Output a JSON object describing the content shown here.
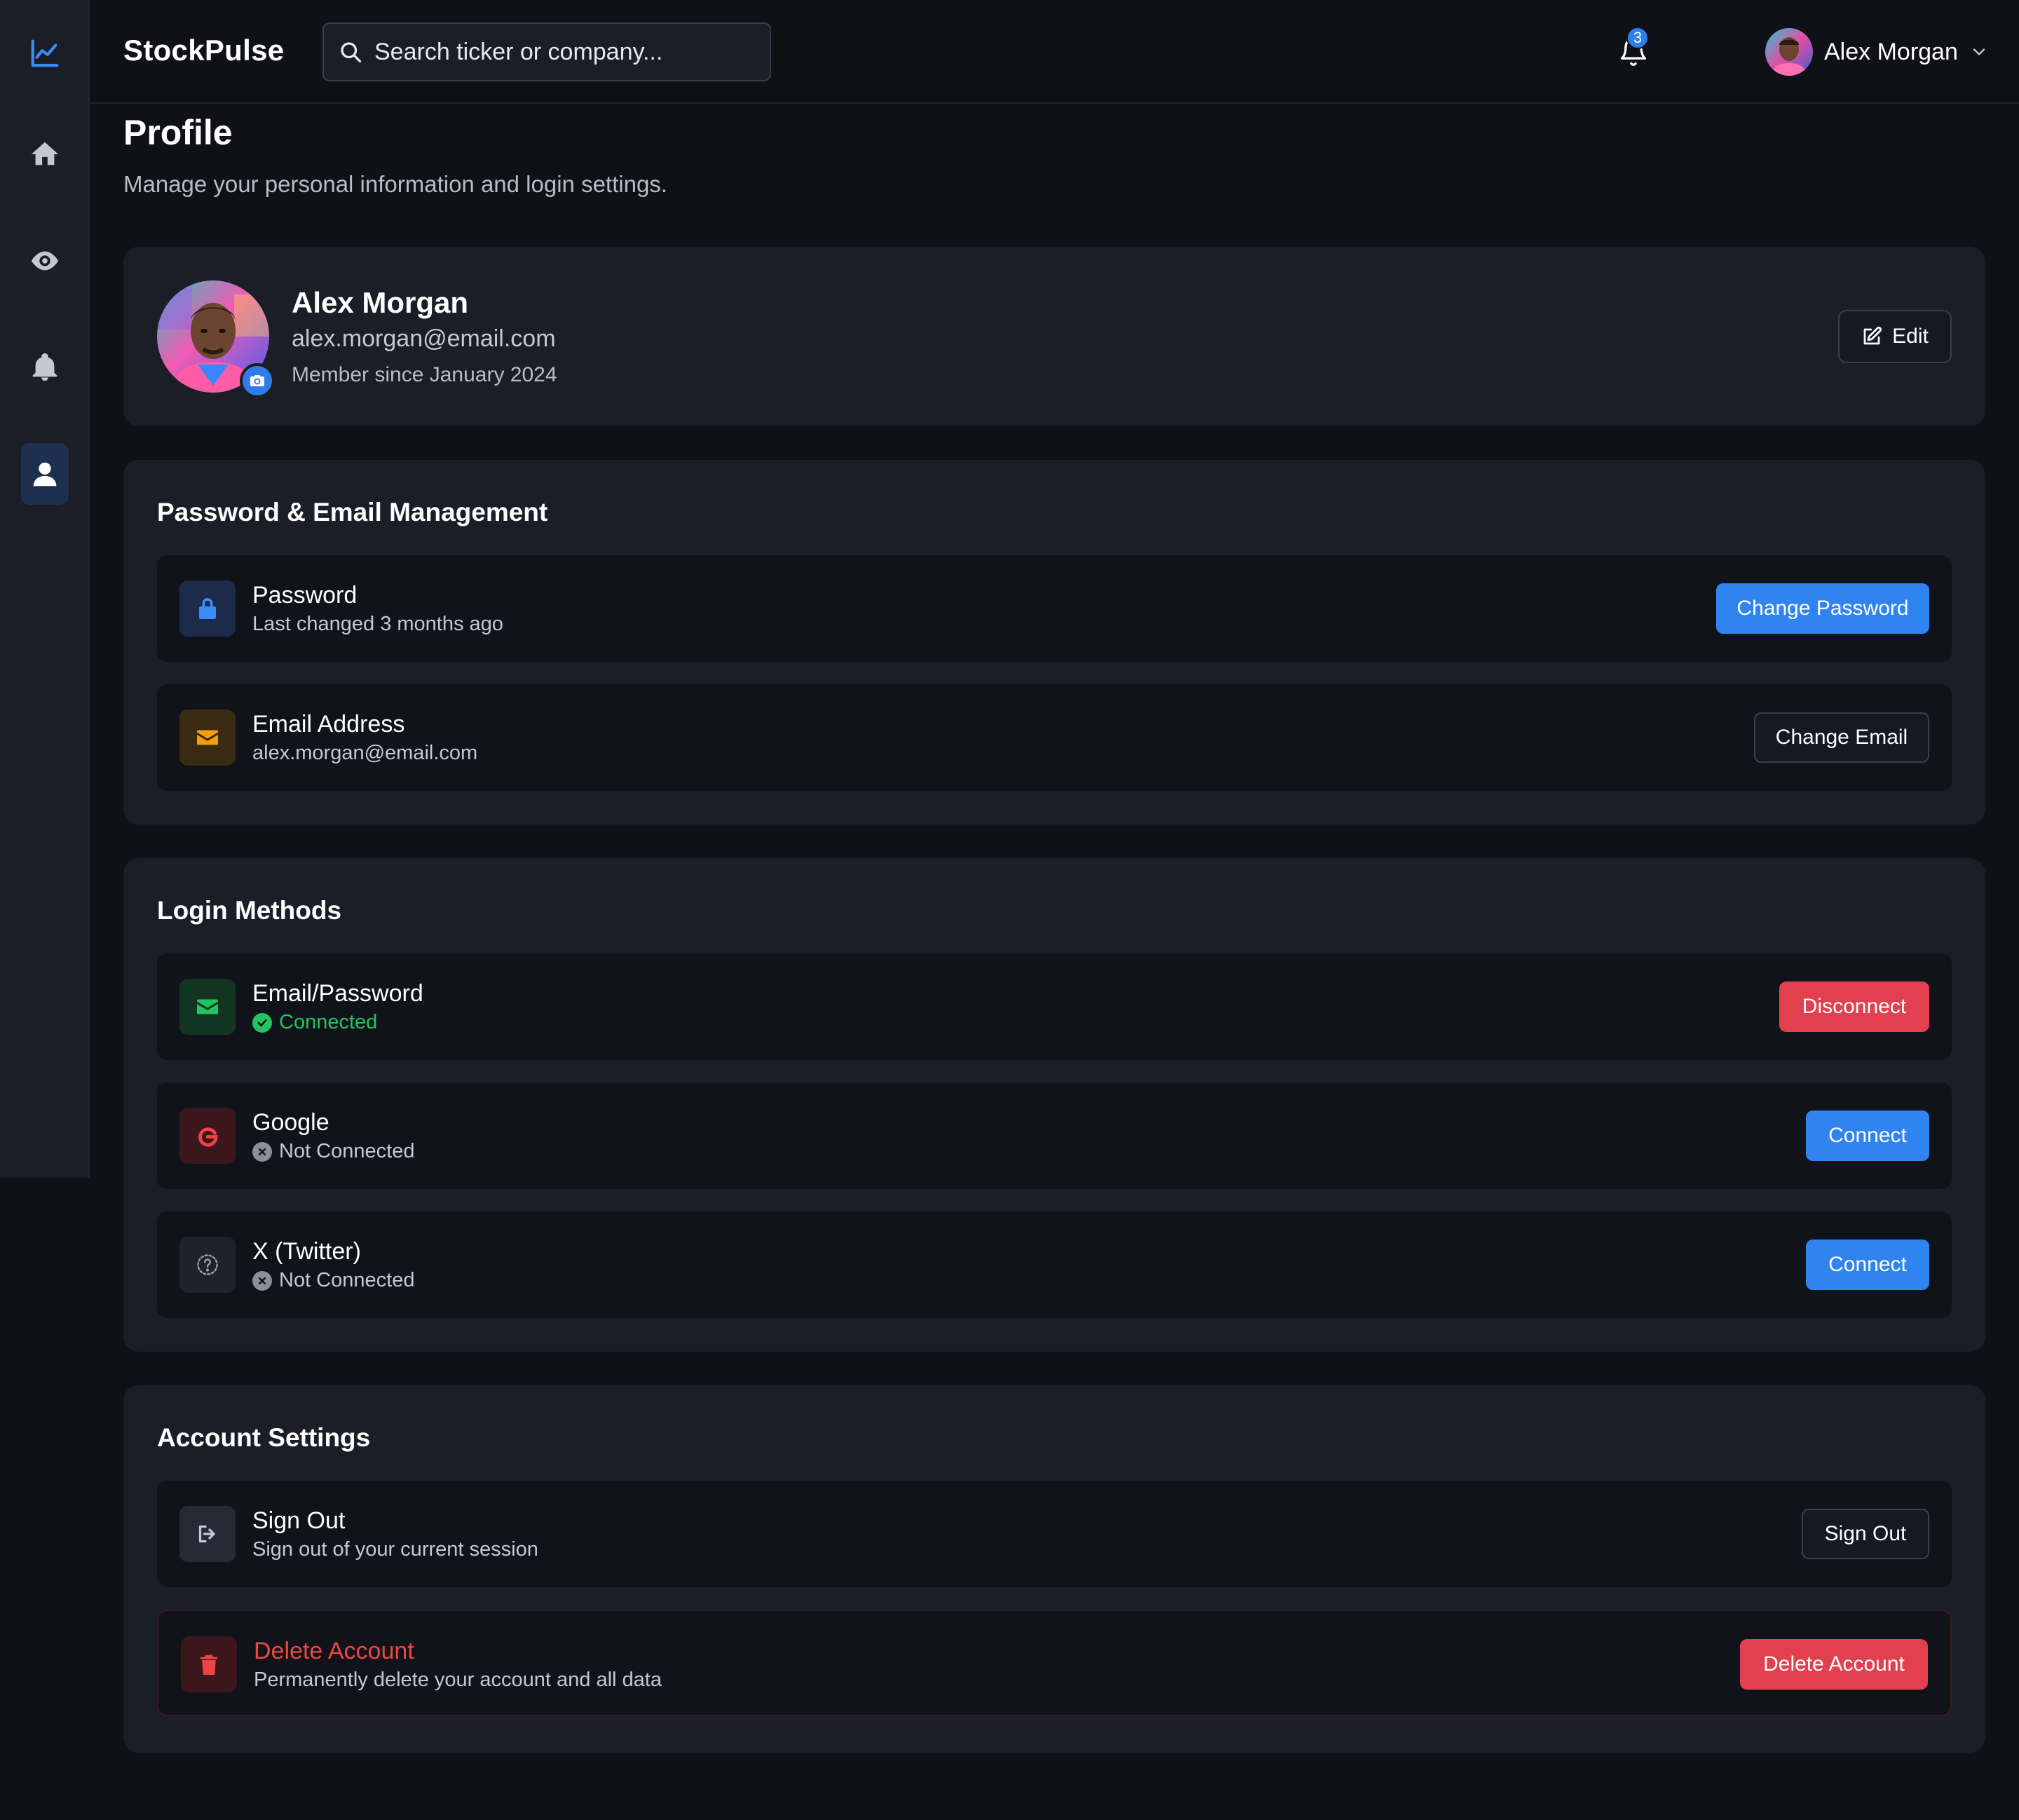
{
  "app": {
    "brand": "StockPulse"
  },
  "search": {
    "placeholder": "Search ticker or company..."
  },
  "header": {
    "notification_count": "3",
    "user_name": "Alex Morgan"
  },
  "page": {
    "title": "Profile",
    "subtitle": "Manage your personal information and login settings."
  },
  "profile": {
    "name": "Alex Morgan",
    "email": "alex.morgan@email.com",
    "member_since": "Member since January 2024",
    "edit_label": "Edit"
  },
  "password_email": {
    "title": "Password & Email Management",
    "password": {
      "title": "Password",
      "subtitle": "Last changed 3 months ago",
      "button": "Change Password"
    },
    "email": {
      "title": "Email Address",
      "subtitle": "alex.morgan@email.com",
      "button": "Change Email"
    }
  },
  "login_methods": {
    "title": "Login Methods",
    "items": [
      {
        "title": "Email/Password",
        "status": "Connected",
        "button": "Disconnect"
      },
      {
        "title": "Google",
        "status": "Not Connected",
        "button": "Connect"
      },
      {
        "title": "X (Twitter)",
        "status": "Not Connected",
        "button": "Connect"
      }
    ]
  },
  "account_settings": {
    "title": "Account Settings",
    "sign_out": {
      "title": "Sign Out",
      "subtitle": "Sign out of your current session",
      "button": "Sign Out"
    },
    "delete": {
      "title": "Delete Account",
      "subtitle": "Permanently delete your account and all data",
      "button": "Delete Account"
    }
  },
  "icons": {
    "sidebar": [
      "chart-line-icon",
      "home-icon",
      "eye-icon",
      "bell-icon",
      "user-icon"
    ]
  },
  "colors": {
    "accent_blue": "#2f84f2",
    "danger_red": "#e23f4f",
    "success_green": "#22c55e",
    "background": "#0f1117",
    "card": "#1b1e27"
  }
}
